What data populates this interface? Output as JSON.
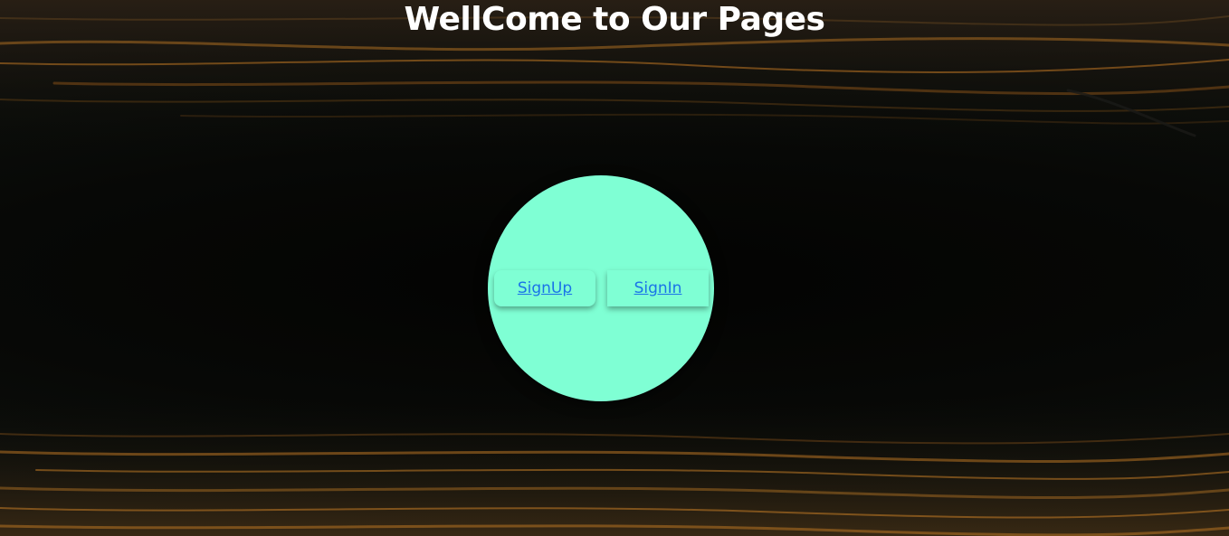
{
  "page": {
    "title": "WellCome to Our Pages"
  },
  "nav": {
    "signup_label": "SignUp",
    "signin_label": "SignIn"
  },
  "colors": {
    "circle": "#7fffd4",
    "link": "#1a73e8",
    "title": "#ffffff",
    "background": "#070806"
  }
}
